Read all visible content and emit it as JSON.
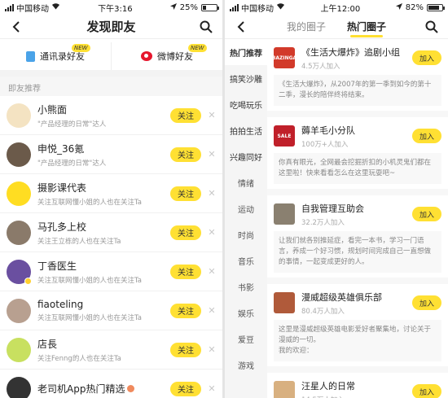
{
  "left": {
    "status": {
      "carrier": "中国移动",
      "time": "下午3:16",
      "battery_pct": "25%",
      "battery_level": 0.25
    },
    "header": {
      "title": "发现即友"
    },
    "invite": {
      "contacts_label": "通讯录好友",
      "weibo_label": "微博好友",
      "new_badge": "NEW"
    },
    "section_label": "即友推荐",
    "follow_label": "关注",
    "recommendations": [
      {
        "name": "小熊面",
        "desc": "\"产品经理的日常\"达人",
        "avatar_color": "#f4e3c2"
      },
      {
        "name": "申悦_36氪",
        "desc": "\"产品经理的日常\"达人",
        "avatar_color": "#6b5a4a"
      },
      {
        "name": "摄影课代表",
        "desc": "关注互联网懂小姐的人也在关注Ta",
        "avatar_color": "#ffdd22"
      },
      {
        "name": "马孔多上校",
        "desc": "关注王立栋的人也在关注Ta",
        "avatar_color": "#8a7a6a"
      },
      {
        "name": "丁香医生",
        "desc": "关注互联网懂小姐的人也在关注Ta",
        "avatar_color": "#6a4fa0"
      },
      {
        "name": "fiaoteling",
        "desc": "关注互联网懂小姐的人也在关注Ta",
        "avatar_color": "#b8a090"
      },
      {
        "name": "店長",
        "desc": "关注Fenng的人也在关注Ta",
        "avatar_color": "#c8e060"
      },
      {
        "name": "老司机App热门精选",
        "desc": "",
        "avatar_color": "#333333"
      }
    ]
  },
  "right": {
    "status": {
      "carrier": "中国移动",
      "time": "上午12:00",
      "battery_pct": "82%",
      "battery_level": 0.82
    },
    "tabs": [
      "我的圈子",
      "热门圈子"
    ],
    "active_tab": "热门圈子",
    "join_label": "加入",
    "categories": [
      {
        "label": "热门推荐",
        "kind": "main"
      },
      {
        "label": "搞笑沙雕",
        "kind": "main"
      },
      {
        "label": "吃喝玩乐",
        "kind": "main"
      },
      {
        "label": "拍拍生活",
        "kind": "main"
      },
      {
        "label": "兴趣同好",
        "kind": "main"
      },
      {
        "label": "情绪",
        "kind": "sub"
      },
      {
        "label": "运动",
        "kind": "sub"
      },
      {
        "label": "时尚",
        "kind": "sub"
      },
      {
        "label": "音乐",
        "kind": "sub"
      },
      {
        "label": "书影",
        "kind": "sub"
      },
      {
        "label": "娱乐",
        "kind": "sub"
      },
      {
        "label": "爱豆",
        "kind": "sub"
      },
      {
        "label": "游戏",
        "kind": "sub"
      }
    ],
    "circles": [
      {
        "name": "《生活大爆炸》追剧小组",
        "count": "4.5万人加入",
        "desc": "《生活大爆炸》，从2007年的第一季到如今的第十二季，漫长的陪伴终将结束。",
        "thumb_color": "#d23a2a",
        "thumb_text": "BAZINGA"
      },
      {
        "name": "薅羊毛小分队",
        "count": "100万+人加入",
        "desc": "你真有眼光，全网最会挖掘折扣的小机灵鬼们都在这里啦！快来看看怎么在这里玩耍吧~",
        "thumb_color": "#c0202a",
        "thumb_text": "SALE"
      },
      {
        "name": "自我管理互助会",
        "count": "32.2万人加入",
        "desc": "让我们就各别推延症，看完一本书，学习一门语言，养成一个好习惯，规划时间完成自己一直想做的事情，一起变成更好的人。",
        "thumb_color": "#8a8070",
        "thumb_text": ""
      },
      {
        "name": "漫威超级英雄俱乐部",
        "count": "80.4万人加入",
        "desc": "这里是漫威超级英雄电影爱好者聚集地，讨论关于漫威的一切。\n我的欢迎：",
        "thumb_color": "#b05a3a",
        "thumb_text": ""
      },
      {
        "name": "汪星人的日常",
        "count": "14.5万人加入",
        "desc": "",
        "thumb_color": "#d8b080",
        "thumb_text": ""
      }
    ]
  }
}
